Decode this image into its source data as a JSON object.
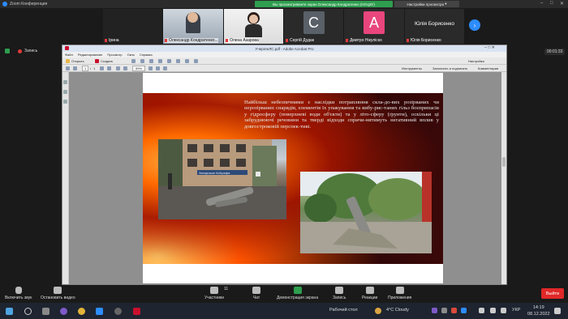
{
  "zoom": {
    "window_title": "Zoom Конференция",
    "share_banner": "Вы просматриваете экран Олександр Кондратенко (НУЦЗУ)",
    "view_settings": "Настройки просмотра",
    "recording_label": "Запись",
    "timer": "00:01:33",
    "participants": [
      {
        "name": "Ірина",
        "kind": "empty"
      },
      {
        "name": "Олександр Кондратенко...",
        "kind": "video"
      },
      {
        "name": "Олена Азарова",
        "kind": "video"
      },
      {
        "name": "Сергій Дудак",
        "kind": "letter",
        "letter": "С",
        "color": "#5a6068"
      },
      {
        "name": "Дмитро Нікуліско",
        "kind": "letter",
        "letter": "А",
        "color": "#e8467c"
      },
      {
        "name": "Юлія Борисенко",
        "kind": "name_only",
        "display": "Юлія Борисенко"
      }
    ],
    "controls": {
      "unmute": "Включить звук",
      "stop_video": "Остановить видео",
      "participants": "Участники",
      "participants_count": "11",
      "chat": "Чат",
      "share": "Демонстрация экрана",
      "record": "Запись",
      "reactions": "Реакции",
      "apps": "Приложения",
      "leave": "Выйти"
    }
  },
  "acrobat": {
    "title": "УчергенЛС.pdf - Adobe Acrobat Pro",
    "menu": [
      "Файл",
      "Редактирование",
      "Просмотр",
      "Окно",
      "Справка"
    ],
    "toolbar": {
      "open": "Открыть",
      "create": "Создать",
      "customize": "Настройка",
      "tools": "Инструменты",
      "sign": "Заполнить и подписать",
      "comments": "Комментарии",
      "page_current": "1",
      "page_total": "1",
      "zoom": "59%"
    }
  },
  "slide": {
    "text": "Найбільш небезпечними є наслідки потрапляння скла-до-вих розірваних чи нерозірваних снарядів, елементів їх упакування та вибу-рис-таних гільз боєприпасів у гідросферу (поверхневі води об'єкти) та у літо-сферу (ґрунти), оскільки ці забруднюючі речовини та тверді відходи спричи-нятимуть негативний вплив у довгостроковій перспек-тиві.",
    "photo1_sign": "Запорізьке КиЇграфа"
  },
  "taskbar": {
    "desktop_label": "Рабочий стол",
    "weather": "4°C Cloudy",
    "lang": "УКР",
    "time": "14:19",
    "date": "08.12.2022"
  }
}
